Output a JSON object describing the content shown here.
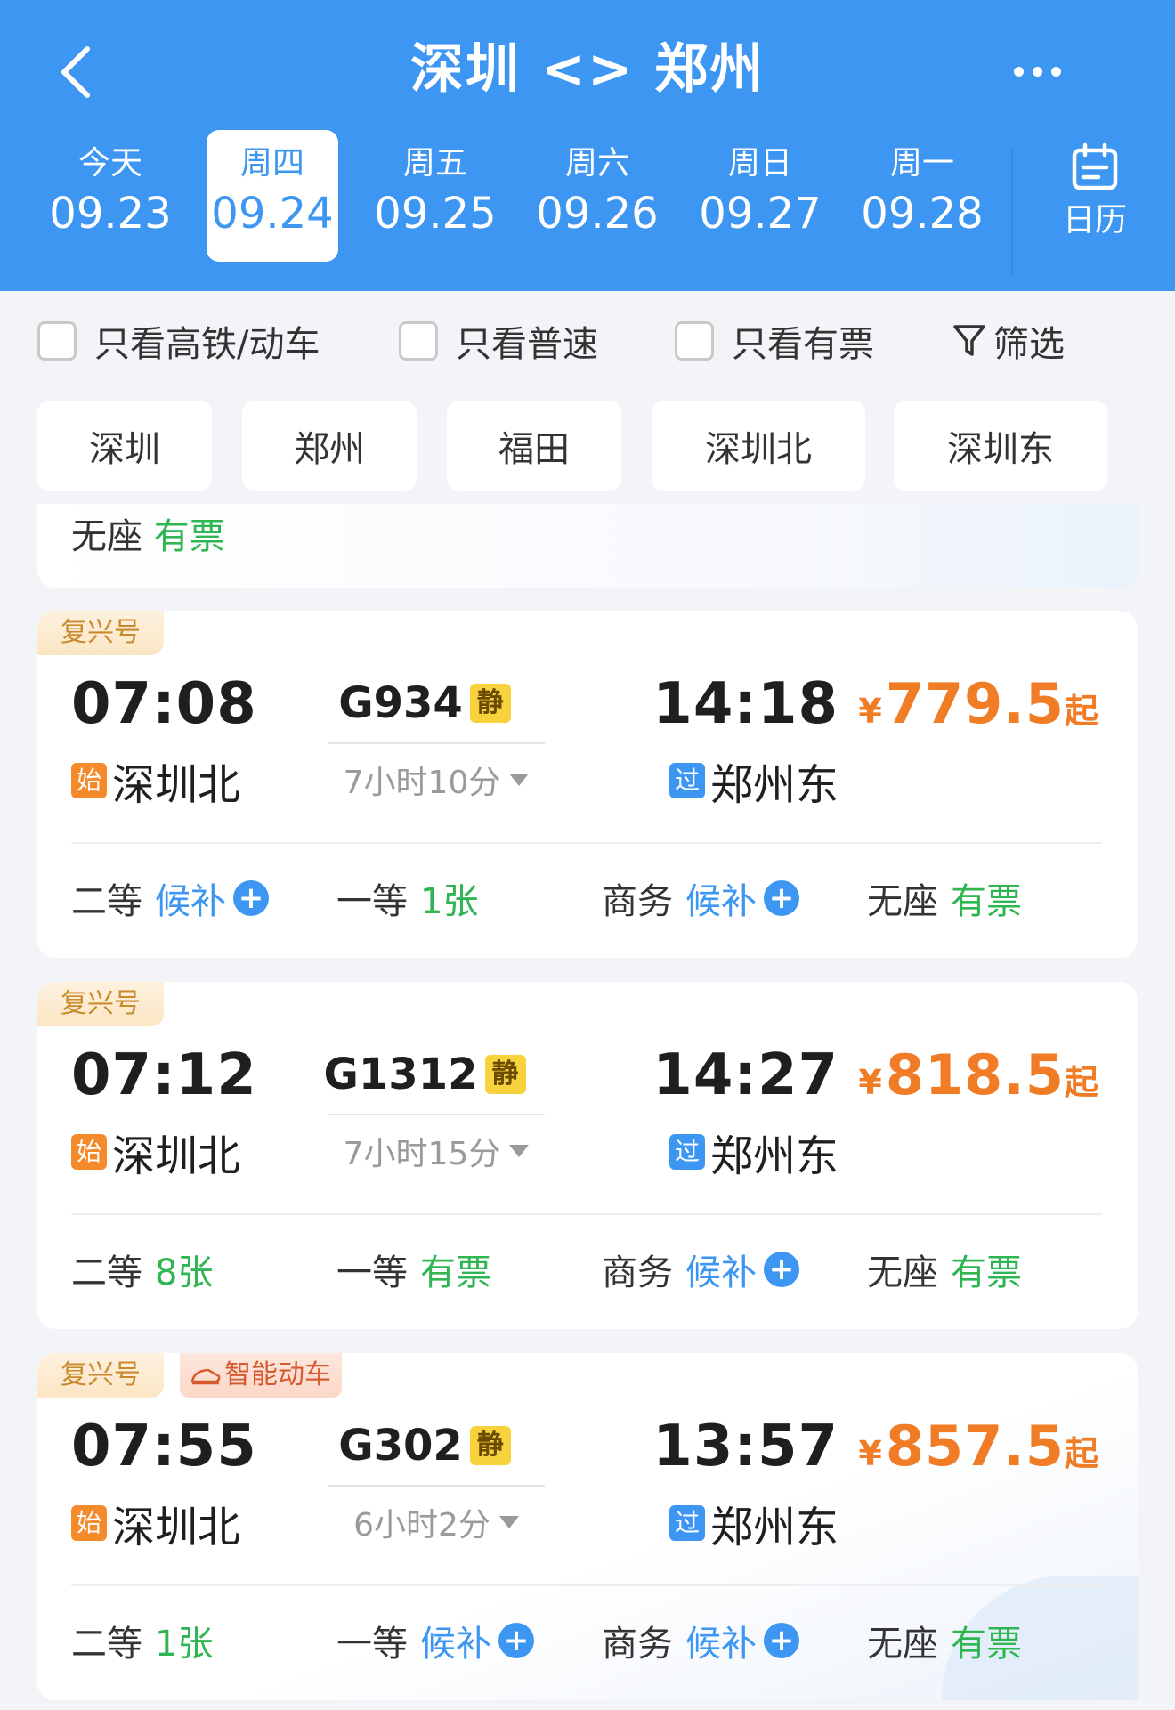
{
  "header": {
    "title": "深圳 <> 郑州",
    "dates": [
      {
        "weekday": "今天",
        "date": "09.23"
      },
      {
        "weekday": "周四",
        "date": "09.24"
      },
      {
        "weekday": "周五",
        "date": "09.25"
      },
      {
        "weekday": "周六",
        "date": "09.26"
      },
      {
        "weekday": "周日",
        "date": "09.27"
      },
      {
        "weekday": "周一",
        "date": "09.28"
      }
    ],
    "calendar_label": "日历"
  },
  "filters": {
    "high_speed": "只看高铁/动车",
    "normal": "只看普速",
    "available": "只看有票",
    "filter": "筛选"
  },
  "stations": [
    "深圳",
    "郑州",
    "福田",
    "深圳北",
    "深圳东"
  ],
  "partial": {
    "seat": "无座",
    "status": "有票"
  },
  "trains": [
    {
      "tag": "复兴号",
      "smart_tag": "",
      "dep_time": "07:08",
      "train_no": "G934",
      "quiet": "静",
      "arr_time": "14:18",
      "duration": "7小时10分",
      "dep_badge": "始",
      "dep_station": "深圳北",
      "arr_badge": "过",
      "arr_station": "郑州东",
      "price_symbol": "¥",
      "price": "779.5",
      "price_suffix": "起",
      "seats": [
        {
          "name": "二等",
          "status": "候补",
          "kind": "wait"
        },
        {
          "name": "一等",
          "status": "1张",
          "kind": "ok"
        },
        {
          "name": "商务",
          "status": "候补",
          "kind": "wait"
        },
        {
          "name": "无座",
          "status": "有票",
          "kind": "ok"
        }
      ]
    },
    {
      "tag": "复兴号",
      "smart_tag": "",
      "dep_time": "07:12",
      "train_no": "G1312",
      "quiet": "静",
      "arr_time": "14:27",
      "duration": "7小时15分",
      "dep_badge": "始",
      "dep_station": "深圳北",
      "arr_badge": "过",
      "arr_station": "郑州东",
      "price_symbol": "¥",
      "price": "818.5",
      "price_suffix": "起",
      "seats": [
        {
          "name": "二等",
          "status": "8张",
          "kind": "ok"
        },
        {
          "name": "一等",
          "status": "有票",
          "kind": "ok"
        },
        {
          "name": "商务",
          "status": "候补",
          "kind": "wait"
        },
        {
          "name": "无座",
          "status": "有票",
          "kind": "ok"
        }
      ]
    },
    {
      "tag": "复兴号",
      "smart_tag": "智能动车",
      "dep_time": "07:55",
      "train_no": "G302",
      "quiet": "静",
      "arr_time": "13:57",
      "duration": "6小时2分",
      "dep_badge": "始",
      "dep_station": "深圳北",
      "arr_badge": "过",
      "arr_station": "郑州东",
      "price_symbol": "¥",
      "price": "857.5",
      "price_suffix": "起",
      "seats": [
        {
          "name": "二等",
          "status": "1张",
          "kind": "ok"
        },
        {
          "name": "一等",
          "status": "候补",
          "kind": "wait"
        },
        {
          "name": "商务",
          "status": "候补",
          "kind": "wait"
        },
        {
          "name": "无座",
          "status": "有票",
          "kind": "ok"
        }
      ]
    }
  ],
  "colors": {
    "header_bg": "#3d96f2",
    "price": "#f07c26",
    "available_green": "#2fb552",
    "waitlist_blue": "#3d96f2",
    "start_badge": "#f58a2a"
  }
}
